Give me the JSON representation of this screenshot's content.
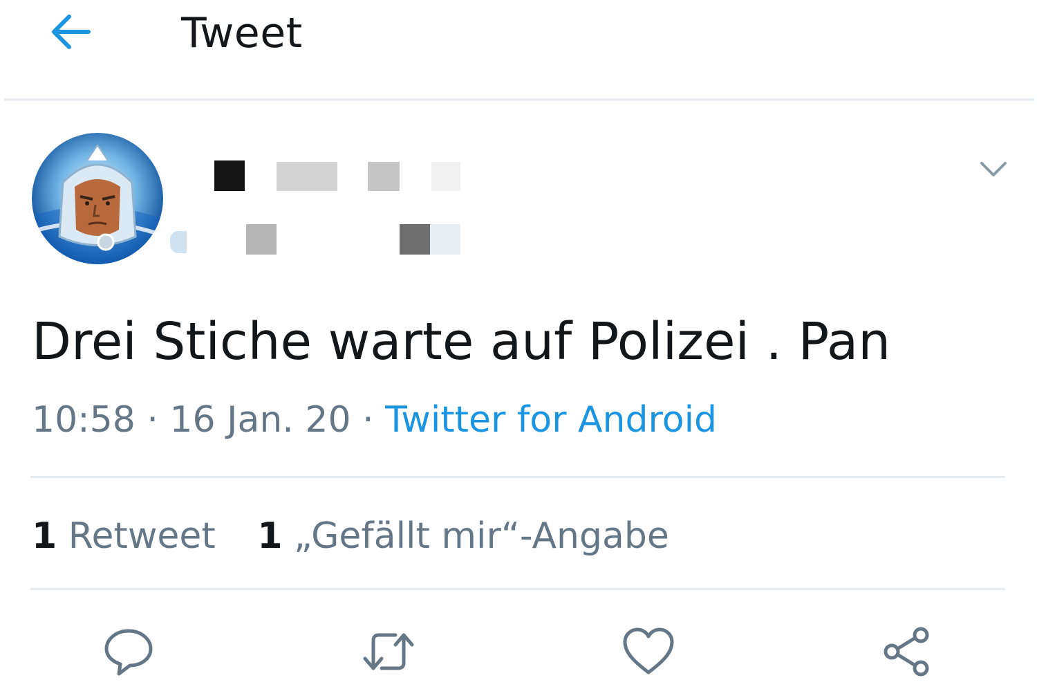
{
  "header": {
    "title": "Tweet",
    "back_icon": "arrow-left-icon",
    "accent_color": "#1b95e0"
  },
  "tweet": {
    "text": "Drei Stiche warte auf Polizei .  Pan",
    "time": "10:58",
    "date": "16 Jan. 20",
    "source": "Twitter for Android",
    "separator": "·"
  },
  "stats": {
    "retweets_count": "1",
    "retweets_label": "Retweet",
    "likes_count": "1",
    "likes_label": "„Gefällt mir“-Angabe"
  },
  "actions": [
    {
      "name": "reply",
      "icon": "reply-icon"
    },
    {
      "name": "retweet",
      "icon": "retweet-icon"
    },
    {
      "name": "like",
      "icon": "heart-icon"
    },
    {
      "name": "share",
      "icon": "share-icon"
    }
  ]
}
